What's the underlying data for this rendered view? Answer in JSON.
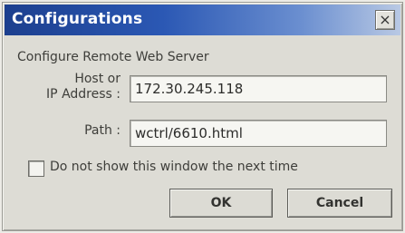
{
  "window": {
    "title": "Configurations",
    "close_glyph": "×"
  },
  "form": {
    "heading": "Configure Remote Web Server",
    "host_label_line1": "Host or",
    "host_label_line2": "IP Address :",
    "host_value": "172.30.245.118",
    "path_label": "Path :",
    "path_value": "wctrl/6610.html",
    "checkbox_label": "Do not show this window the next time",
    "checkbox_checked": false
  },
  "buttons": {
    "ok_label": "OK",
    "cancel_label": "Cancel"
  },
  "icons": {
    "close": "close-icon"
  },
  "colors": {
    "titlebar_start": "#1c3f8e",
    "titlebar_end": "#b9c9e4",
    "dialog_bg": "#dddcd5"
  }
}
